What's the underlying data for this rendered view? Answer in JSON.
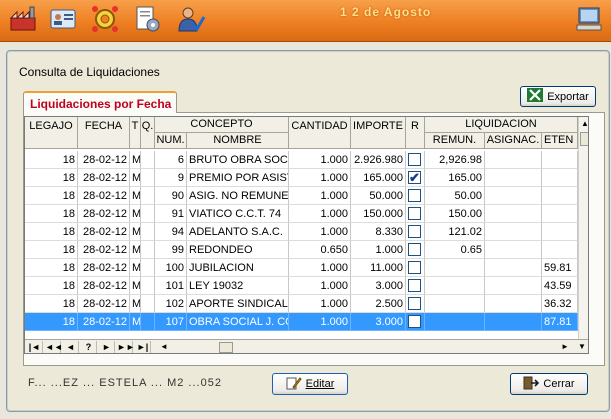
{
  "app": {
    "title": "1 2 de Agosto"
  },
  "window": {
    "title": "Consulta de Liquidaciones",
    "tab_label": "Liquidaciones por Fecha",
    "export_label": "Exportar",
    "edit_label": "Editar",
    "close_label": "Cerrar",
    "status_text": "F... ...EZ ... ESTELA ... M2 ...052"
  },
  "grid": {
    "headers_top": {
      "legajo": "LEGAJO",
      "fecha": "FECHA",
      "t": "T",
      "q": "Q.",
      "concepto": "CONCEPTO",
      "cantidad": "CANTIDAD",
      "importe": "IMPORTE",
      "r": "R",
      "liquidacion": "LIQUIDACION"
    },
    "headers_sub": {
      "num": "NUM.",
      "nombre": "NOMBRE",
      "remun": "REMUN.",
      "asignac": "ASIGNAC.",
      "reten": "ETEN"
    },
    "rows": [
      {
        "legajo": "18",
        "fecha": "28-02-12",
        "t": "M",
        "q": "",
        "num": "6",
        "nombre": "BRUTO OBRA SOCIA",
        "cantidad": "1.000",
        "importe": "2.926.980",
        "checked": "",
        "remun": "2,926.98",
        "asignac": "",
        "reten": ""
      },
      {
        "legajo": "18",
        "fecha": "28-02-12",
        "t": "M",
        "q": "",
        "num": "9",
        "nombre": "PREMIO POR ASIST",
        "cantidad": "1.000",
        "importe": "165.000",
        "checked": "✔",
        "remun": "165.00",
        "asignac": "",
        "reten": ""
      },
      {
        "legajo": "18",
        "fecha": "28-02-12",
        "t": "M",
        "q": "",
        "num": "90",
        "nombre": "ASIG. NO REMUNER",
        "cantidad": "1.000",
        "importe": "50.000",
        "checked": "",
        "remun": "50.00",
        "asignac": "",
        "reten": ""
      },
      {
        "legajo": "18",
        "fecha": "28-02-12",
        "t": "M",
        "q": "",
        "num": "91",
        "nombre": "VIATICO C.C.T. 74",
        "cantidad": "1.000",
        "importe": "150.000",
        "checked": "",
        "remun": "150.00",
        "asignac": "",
        "reten": ""
      },
      {
        "legajo": "18",
        "fecha": "28-02-12",
        "t": "M",
        "q": "",
        "num": "94",
        "nombre": "ADELANTO S.A.C.",
        "cantidad": "1.000",
        "importe": "8.330",
        "checked": "",
        "remun": "121.02",
        "asignac": "",
        "reten": ""
      },
      {
        "legajo": "18",
        "fecha": "28-02-12",
        "t": "M",
        "q": "",
        "num": "99",
        "nombre": "REDONDEO",
        "cantidad": "0.650",
        "importe": "1.000",
        "checked": "",
        "remun": "0.65",
        "asignac": "",
        "reten": ""
      },
      {
        "legajo": "18",
        "fecha": "28-02-12",
        "t": "M",
        "q": "",
        "num": "100",
        "nombre": "JUBILACION",
        "cantidad": "1.000",
        "importe": "11.000",
        "checked": "",
        "remun": "",
        "asignac": "",
        "reten": "59.81"
      },
      {
        "legajo": "18",
        "fecha": "28-02-12",
        "t": "M",
        "q": "",
        "num": "101",
        "nombre": "LEY 19032",
        "cantidad": "1.000",
        "importe": "3.000",
        "checked": "",
        "remun": "",
        "asignac": "",
        "reten": "43.59"
      },
      {
        "legajo": "18",
        "fecha": "28-02-12",
        "t": "M",
        "q": "",
        "num": "102",
        "nombre": "APORTE SINDICAL",
        "cantidad": "1.000",
        "importe": "2.500",
        "checked": "",
        "remun": "",
        "asignac": "",
        "reten": "36.32"
      },
      {
        "legajo": "18",
        "fecha": "28-02-12",
        "t": "M",
        "q": "",
        "num": "107",
        "nombre": "OBRA SOCIAL J. CO",
        "cantidad": "1.000",
        "importe": "3.000",
        "checked": "",
        "remun": "",
        "asignac": "",
        "reten": "87.81"
      }
    ],
    "selected_row": 9,
    "nav_buttons": [
      "|◄",
      "◄◄",
      "◄",
      "?",
      "►",
      "►►",
      "►|"
    ]
  },
  "colors": {
    "toolbar": "#ee7f22",
    "selection": "#3399ff",
    "tab_text": "#c0001c"
  }
}
